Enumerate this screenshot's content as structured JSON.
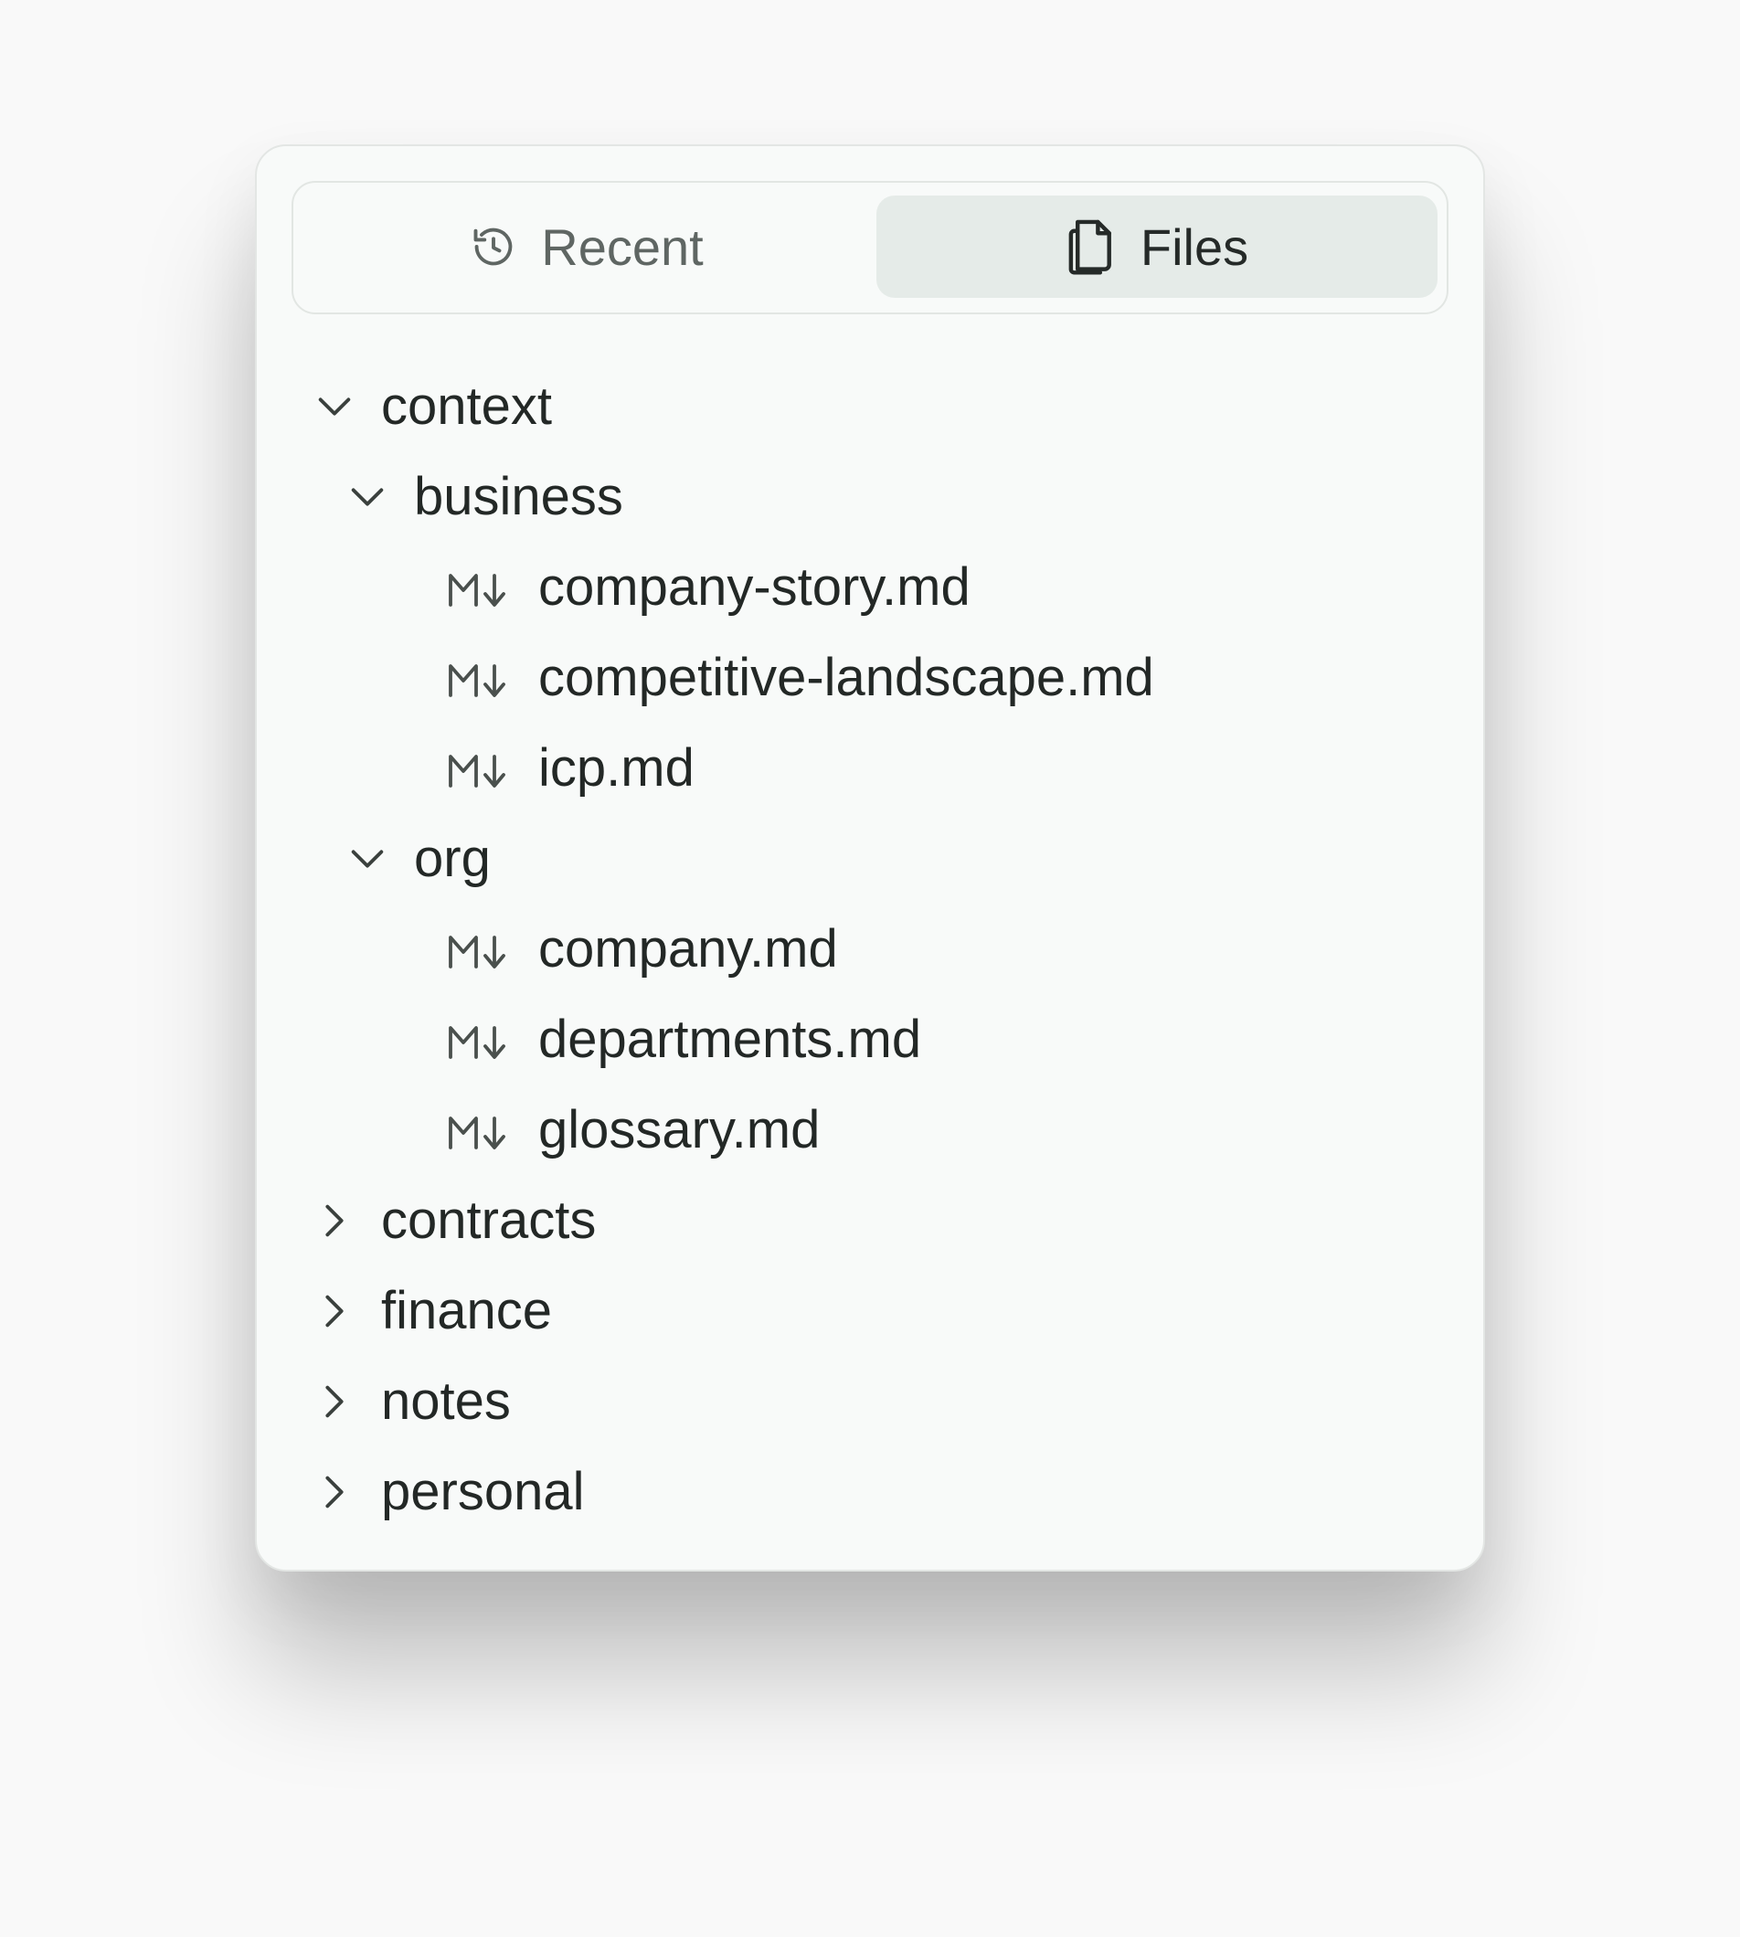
{
  "tabs": {
    "recent": {
      "label": "Recent",
      "icon": "history-icon"
    },
    "files": {
      "label": "Files",
      "icon": "files-icon",
      "active": true
    }
  },
  "tree": {
    "context": {
      "label": "context",
      "expanded": true
    },
    "business": {
      "label": "business",
      "expanded": true
    },
    "business_files": [
      "company-story.md",
      "competitive-landscape.md",
      "icp.md"
    ],
    "org": {
      "label": "org",
      "expanded": true
    },
    "org_files": [
      "company.md",
      "departments.md",
      "glossary.md"
    ],
    "collapsed_folders": [
      "contracts",
      "finance",
      "notes",
      "personal"
    ]
  },
  "colors": {
    "panel_bg": "#f8faf9",
    "active_tab_bg": "#e5ebe8",
    "text": "#232826",
    "muted": "#5f6663"
  }
}
